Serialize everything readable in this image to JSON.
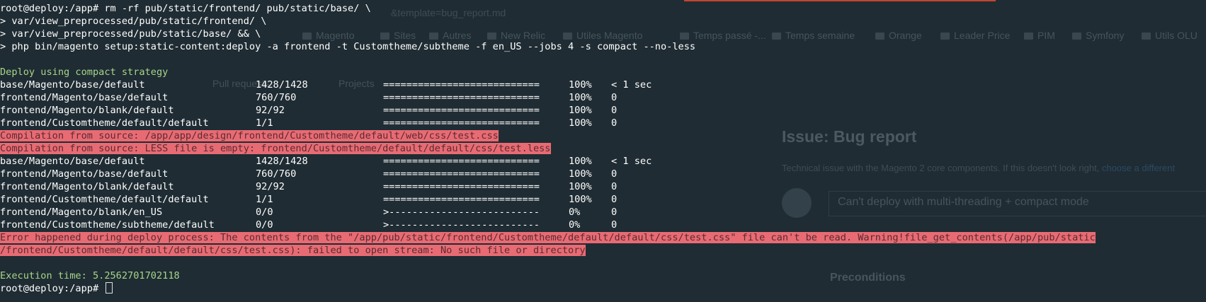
{
  "background_browser": {
    "url_fragment": "&template=bug_report.md",
    "bookmarks": [
      "Magento",
      "Sites",
      "Autres",
      "New Relic",
      "Utiles Magento",
      "Temps passé -...",
      "Temps semaine",
      "Orange",
      "Leader Price",
      "PIM",
      "Symfony",
      "Utils OLU"
    ],
    "github_tabs": [
      "Pull requests",
      "Projects"
    ],
    "issue_title": "Issue: Bug report",
    "issue_description": "Technical issue with the Magento 2 core components. If this doesn't look right,",
    "issue_description_link": "choose a different",
    "issue_title_input": "Can't deploy with multi-threading + compact mode",
    "preconditions_heading": "Preconditions"
  },
  "terminal": {
    "command_lines": [
      "root@deploy:/app# rm -rf pub/static/frontend/ pub/static/base/ \\",
      "> var/view_preprocessed/pub/static/frontend/ \\",
      "> var/view_preprocessed/pub/static/base/ && \\",
      "> php bin/magento setup:static-content:deploy -a frontend -t Customtheme/subtheme -f en_US --jobs 4 -s compact --no-less"
    ],
    "strategy_line": "Deploy using compact strategy",
    "progress_block_1": [
      {
        "path": "base/Magento/base/default",
        "count": "1428/1428",
        "bar": "===========================",
        "pct": "100%",
        "time": "< 1 sec"
      },
      {
        "path": "frontend/Magento/base/default",
        "count": "760/760",
        "bar": "===========================",
        "pct": "100%",
        "time": "0"
      },
      {
        "path": "frontend/Magento/blank/default",
        "count": "92/92",
        "bar": "===========================",
        "pct": "100%",
        "time": "0"
      },
      {
        "path": "frontend/Customtheme/default/default",
        "count": "1/1",
        "bar": "===========================",
        "pct": "100%",
        "time": "0"
      }
    ],
    "compile_errors": [
      "Compilation from source: /app/app/design/frontend/Customtheme/default/web/css/test.css",
      "Compilation from source: LESS file is empty: frontend/Customtheme/default/default/css/test.less"
    ],
    "progress_block_2": [
      {
        "path": "base/Magento/base/default",
        "count": "1428/1428",
        "bar": "===========================",
        "pct": "100%",
        "time": "< 1 sec"
      },
      {
        "path": "frontend/Magento/base/default",
        "count": "760/760",
        "bar": "===========================",
        "pct": "100%",
        "time": "0"
      },
      {
        "path": "frontend/Magento/blank/default",
        "count": "92/92",
        "bar": "===========================",
        "pct": "100%",
        "time": "0"
      },
      {
        "path": "frontend/Customtheme/default/default",
        "count": "1/1",
        "bar": "===========================",
        "pct": "100%",
        "time": "0"
      },
      {
        "path": "frontend/Magento/blank/en_US",
        "count": "0/0",
        "bar": ">--------------------------",
        "pct": "0%",
        "time": "0"
      },
      {
        "path": "frontend/Customtheme/subtheme/default",
        "count": "0/0",
        "bar": ">--------------------------",
        "pct": "0%",
        "time": "0"
      }
    ],
    "deploy_error": [
      "Error happened during deploy process: The contents from the \"/app/pub/static/frontend/Customtheme/default/default/css/test.css\" file can't be read. Warning!file_get_contents(/app/pub/static",
      "/frontend/Customtheme/default/default/css/test.css): failed to open stream: No such file or directory"
    ],
    "execution_time": "Execution time: 5.2562701702118",
    "prompt": "root@deploy:/app# ",
    "colors": {
      "background": "#1f2c33",
      "text": "#ffffff",
      "green": "#a8d58a",
      "error_bg": "#e86b74"
    }
  }
}
